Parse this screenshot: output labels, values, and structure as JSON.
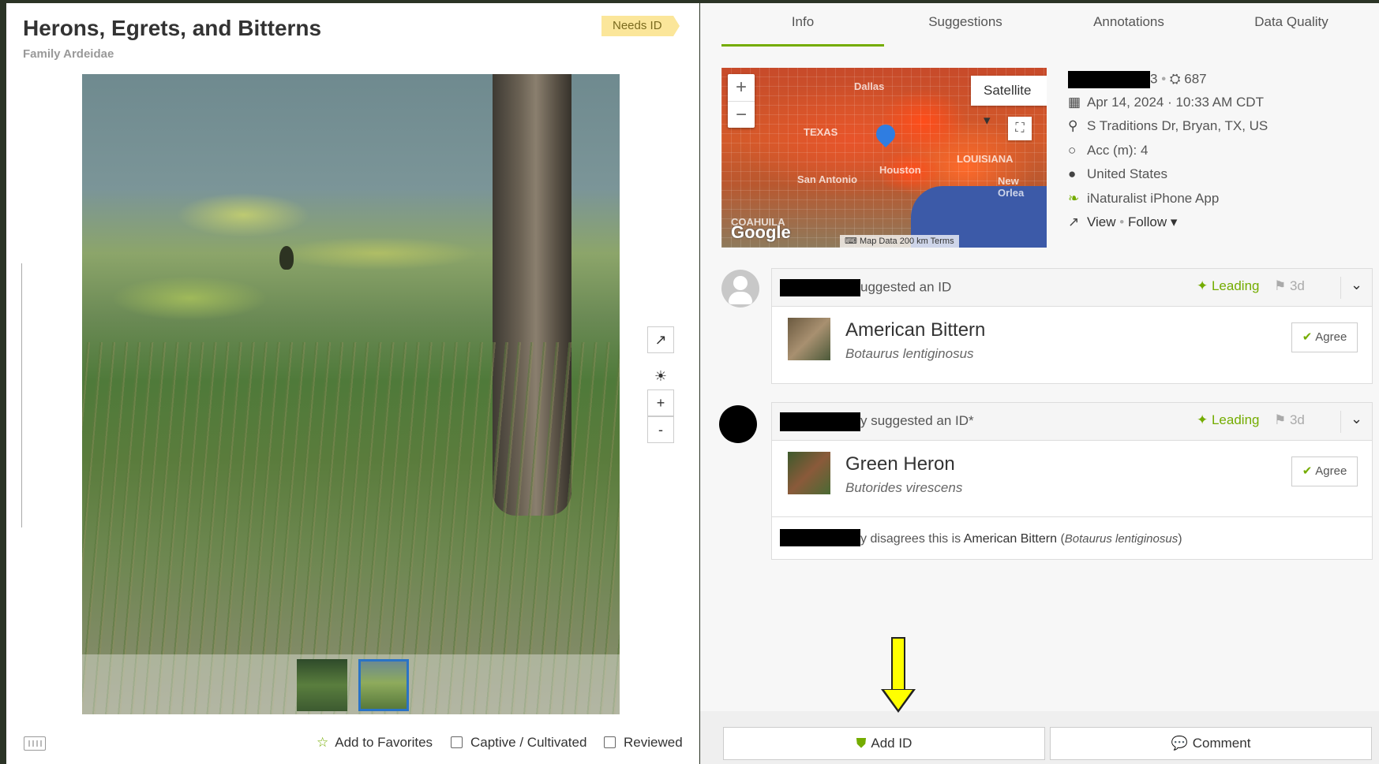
{
  "observation": {
    "title": "Herons, Egrets, and Bitterns",
    "family": "Family Ardeidae",
    "quality_badge": "Needs ID"
  },
  "photo_tools": {
    "external_link_icon": "external-link-icon",
    "brightness_icon": "sun-icon",
    "zoom_in": "+",
    "zoom_out": "-"
  },
  "bottom_bar": {
    "favorites_label": "Add to Favorites",
    "captive_label": "Captive / Cultivated",
    "reviewed_label": "Reviewed"
  },
  "tabs": [
    {
      "label": "Info",
      "active": true
    },
    {
      "label": "Suggestions",
      "active": false
    },
    {
      "label": "Annotations",
      "active": false
    },
    {
      "label": "Data Quality",
      "active": false
    }
  ],
  "map": {
    "zoom_in": "+",
    "zoom_out": "−",
    "map_type": "Satellite",
    "google_logo": "Google",
    "attribution": "Map Data",
    "scale": "200 km",
    "terms": "Terms",
    "labels": {
      "dallas": "Dallas",
      "texas": "TEXAS",
      "san_antonio": "San Antonio",
      "houston": "Houston",
      "louisiana": "LOUISIANA",
      "new_orleans": "New Orlea",
      "coahuila": "COAHUILA"
    }
  },
  "meta": {
    "user_suffix": "3",
    "observation_count": "687",
    "date": "Apr 14, 2024 · 10:33 AM CDT",
    "location": "S Traditions Dr, Bryan, TX, US",
    "accuracy": "Acc (m): 4",
    "country": "United States",
    "app": "iNaturalist iPhone App",
    "view_label": "View",
    "follow_label": "Follow"
  },
  "identifications": [
    {
      "action_text": "uggested an ID",
      "status": "Leading",
      "age": "3d",
      "common_name": "American Bittern",
      "scientific_name": "Botaurus lentiginosus",
      "agree_label": "Agree"
    },
    {
      "user_fragment": "y suggested an ID*",
      "status": "Leading",
      "age": "3d",
      "common_name": "Green Heron",
      "scientific_name": "Butorides virescens",
      "agree_label": "Agree",
      "disagreement": {
        "text": "y disagrees this is",
        "taxon_common": "American Bittern",
        "taxon_scientific": "Botaurus lentiginosus"
      }
    }
  ],
  "actions": {
    "add_id_label": "Add ID",
    "comment_label": "Comment"
  },
  "colors": {
    "accent_green": "#74ac00",
    "needs_id_bg": "#fbe69a",
    "annotation_arrow": "#ffff00"
  }
}
